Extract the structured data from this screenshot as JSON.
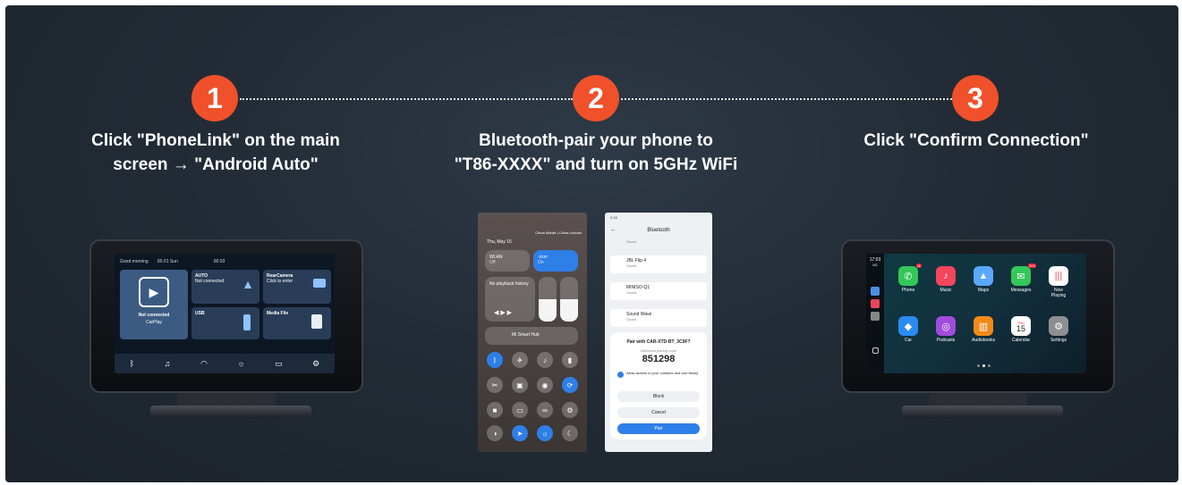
{
  "steps": [
    {
      "number": "1",
      "text_line1": "Click \"PhoneLink\" on the main",
      "text_line2": "screen → \"Android Auto\""
    },
    {
      "number": "2",
      "text_line1": "Bluetooth-pair your phone to",
      "text_line2": "\"T86-XXXX\" and turn on 5GHz WiFi"
    },
    {
      "number": "3",
      "text_line1": "Click \"Confirm Connection\"",
      "text_line2": ""
    }
  ],
  "colors": {
    "accent": "#f0502a",
    "background": "#232c36",
    "text": "#ffffff"
  },
  "device1": {
    "greeting": "Good morning",
    "date": "05-01 Sun",
    "time": "00:03",
    "tile_carplay_label": "Not connected",
    "tile_carplay_sub": "CarPlay",
    "tile_auto_title": "AUTO",
    "tile_auto_sub": "Not connected",
    "tile_rear_title": "RearCamera",
    "tile_rear_sub": "Click to enter",
    "tile_usb": "USB",
    "tile_media": "Media File"
  },
  "phone_cc": {
    "carrier": "China Mobile | China Unicom",
    "date": "Thu, May 15",
    "wlan": "WLAN",
    "wlan_sub": "Off",
    "icon_tile": "-icon",
    "icon_tile_sub": "On",
    "media": "No playback history",
    "hub": "Mi Smart Hub"
  },
  "phone_bt": {
    "time": "2:15",
    "title": "Bluetooth",
    "saved_top": "Saved",
    "devices": [
      {
        "name": "JBL Flip 4",
        "status": "Saved"
      },
      {
        "name": "MINISO-Q1",
        "status": "Saved"
      },
      {
        "name": "Sound Wave",
        "status": "Saved"
      }
    ],
    "dialog_title": "Pair with CAR-XTD-BT_3C9F?",
    "dialog_code_label": "Bluetooth pairing code",
    "dialog_code": "851298",
    "dialog_allow": "Allow access to your contacts and call history",
    "btn_block": "Block",
    "btn_cancel": "Cancel",
    "btn_pair": "Pair"
  },
  "device3": {
    "time": "17:03",
    "network": "5G",
    "phone_badge": "11",
    "messages_badge": "574",
    "calendar_day": "THU",
    "calendar_date": "15",
    "apps": [
      "Phone",
      "Music",
      "Maps",
      "Messages",
      "Now Playing",
      "Car",
      "Podcasts",
      "Audiobooks",
      "Calendar",
      "Settings"
    ]
  }
}
